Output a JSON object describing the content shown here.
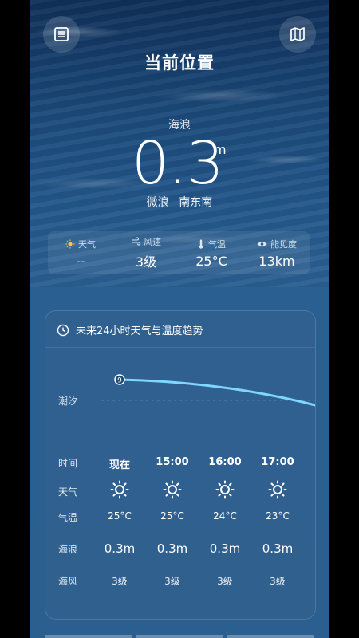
{
  "header": {
    "title": "当前位置",
    "left_icon": "list-icon",
    "right_icon": "map-icon"
  },
  "wave": {
    "label": "海浪",
    "value": "0.3",
    "unit": "m",
    "level": "微浪",
    "direction": "南东南"
  },
  "stats": [
    {
      "icon": "sun-icon",
      "label": "天气",
      "value": "--"
    },
    {
      "icon": "wind-icon",
      "label": "风速",
      "value": "3级"
    },
    {
      "icon": "thermometer-icon",
      "label": "气温",
      "value": "25°C"
    },
    {
      "icon": "eye-icon",
      "label": "能见度",
      "value": "13km"
    }
  ],
  "forecast": {
    "title": "未来24小时天气与温度趋势",
    "tide_label": "潮汐",
    "tide_marker": "9",
    "row_labels": {
      "time": "时间",
      "weather": "天气",
      "temp": "气温",
      "wave": "海浪",
      "wind": "海风"
    },
    "columns": [
      {
        "time": "现在",
        "weather": "sun-icon",
        "temp": "25°C",
        "wave": "0.3m",
        "wind": "3级"
      },
      {
        "time": "15:00",
        "weather": "sun-icon",
        "temp": "25°C",
        "wave": "0.3m",
        "wind": "3级"
      },
      {
        "time": "16:00",
        "weather": "sun-icon",
        "temp": "24°C",
        "wave": "0.3m",
        "wind": "3级"
      },
      {
        "time": "17:00",
        "weather": "sun-icon",
        "temp": "23°C",
        "wave": "0.3m",
        "wind": "3级"
      }
    ]
  },
  "colors": {
    "tide_line": "#7fd6ff",
    "sun_icon_stats": "#ffc24a"
  }
}
